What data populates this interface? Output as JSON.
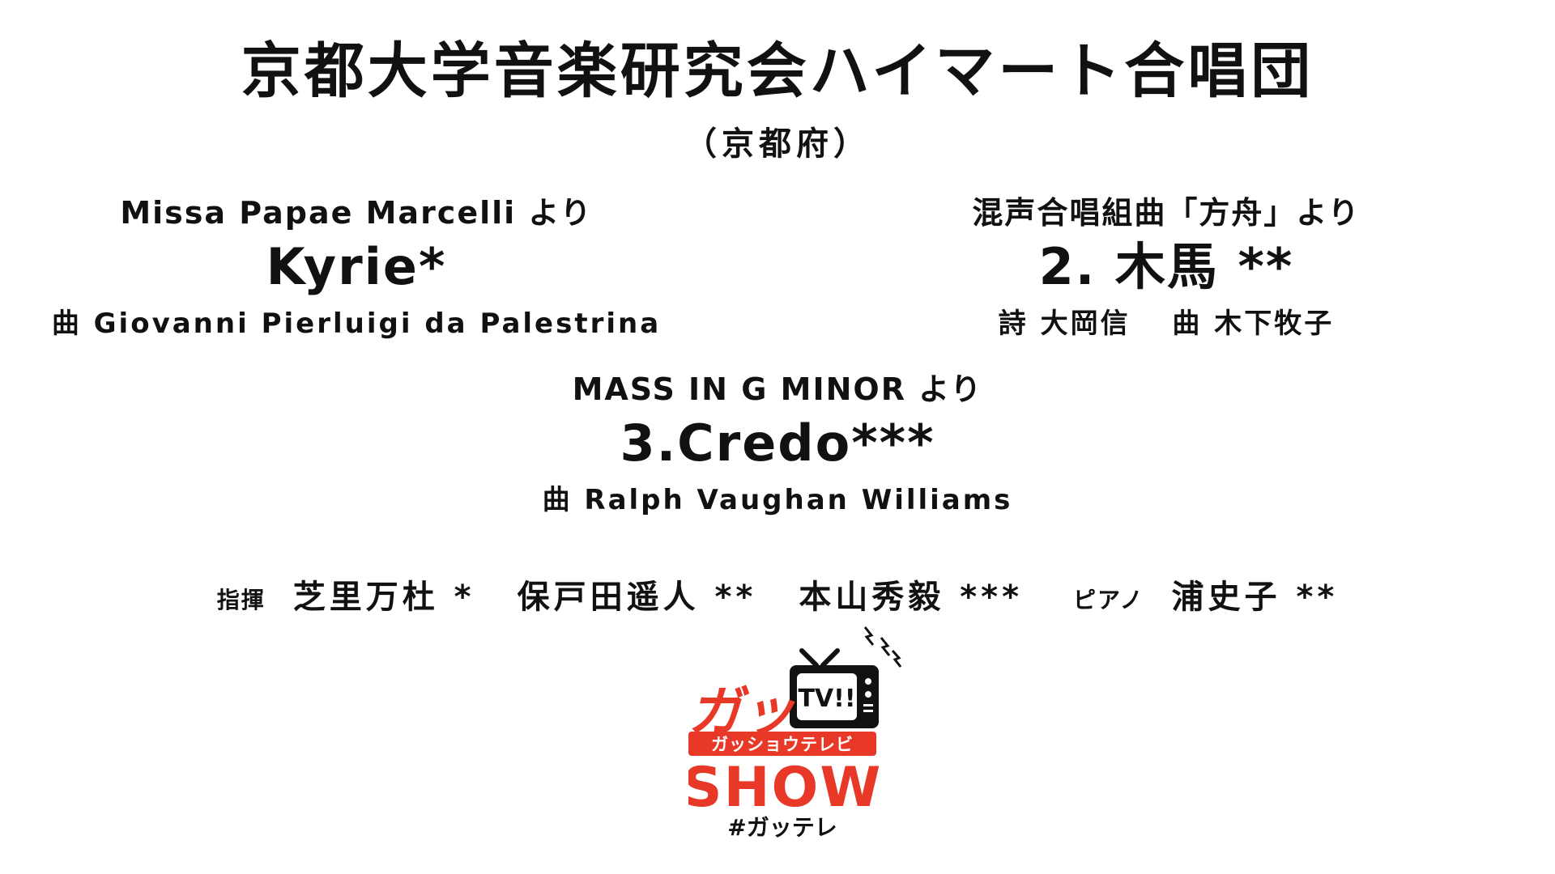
{
  "choir": {
    "name": "京都大学音楽研究会ハイマート合唱団",
    "prefecture": "（京都府）"
  },
  "pieces": [
    {
      "source": "Missa Papae Marcelli より",
      "title": "Kyrie*",
      "credit": "曲 Giovanni Pierluigi da Palestrina"
    },
    {
      "source": "混声合唱組曲「方舟」より",
      "title": "2. 木馬 **",
      "credit": "詩 大岡信　 曲 木下牧子"
    },
    {
      "source": "MASS IN G MINOR より",
      "title": "3.Credo***",
      "credit": "曲 Ralph Vaughan Williams"
    }
  ],
  "staff": {
    "conductor_label": "指揮",
    "conductors": [
      "芝里万杜 *",
      "保戸田遥人 **",
      "本山秀毅 ***"
    ],
    "piano_label": "ピアノ",
    "pianist": "浦史子 **"
  },
  "logo": {
    "main": "ガッ",
    "tv": "TV!!",
    "subtitle": "ガッショウテレビ",
    "show": "SHOW",
    "hashtag": "#ガッテレ",
    "colors": {
      "red": "#e83828",
      "black": "#111111"
    }
  }
}
